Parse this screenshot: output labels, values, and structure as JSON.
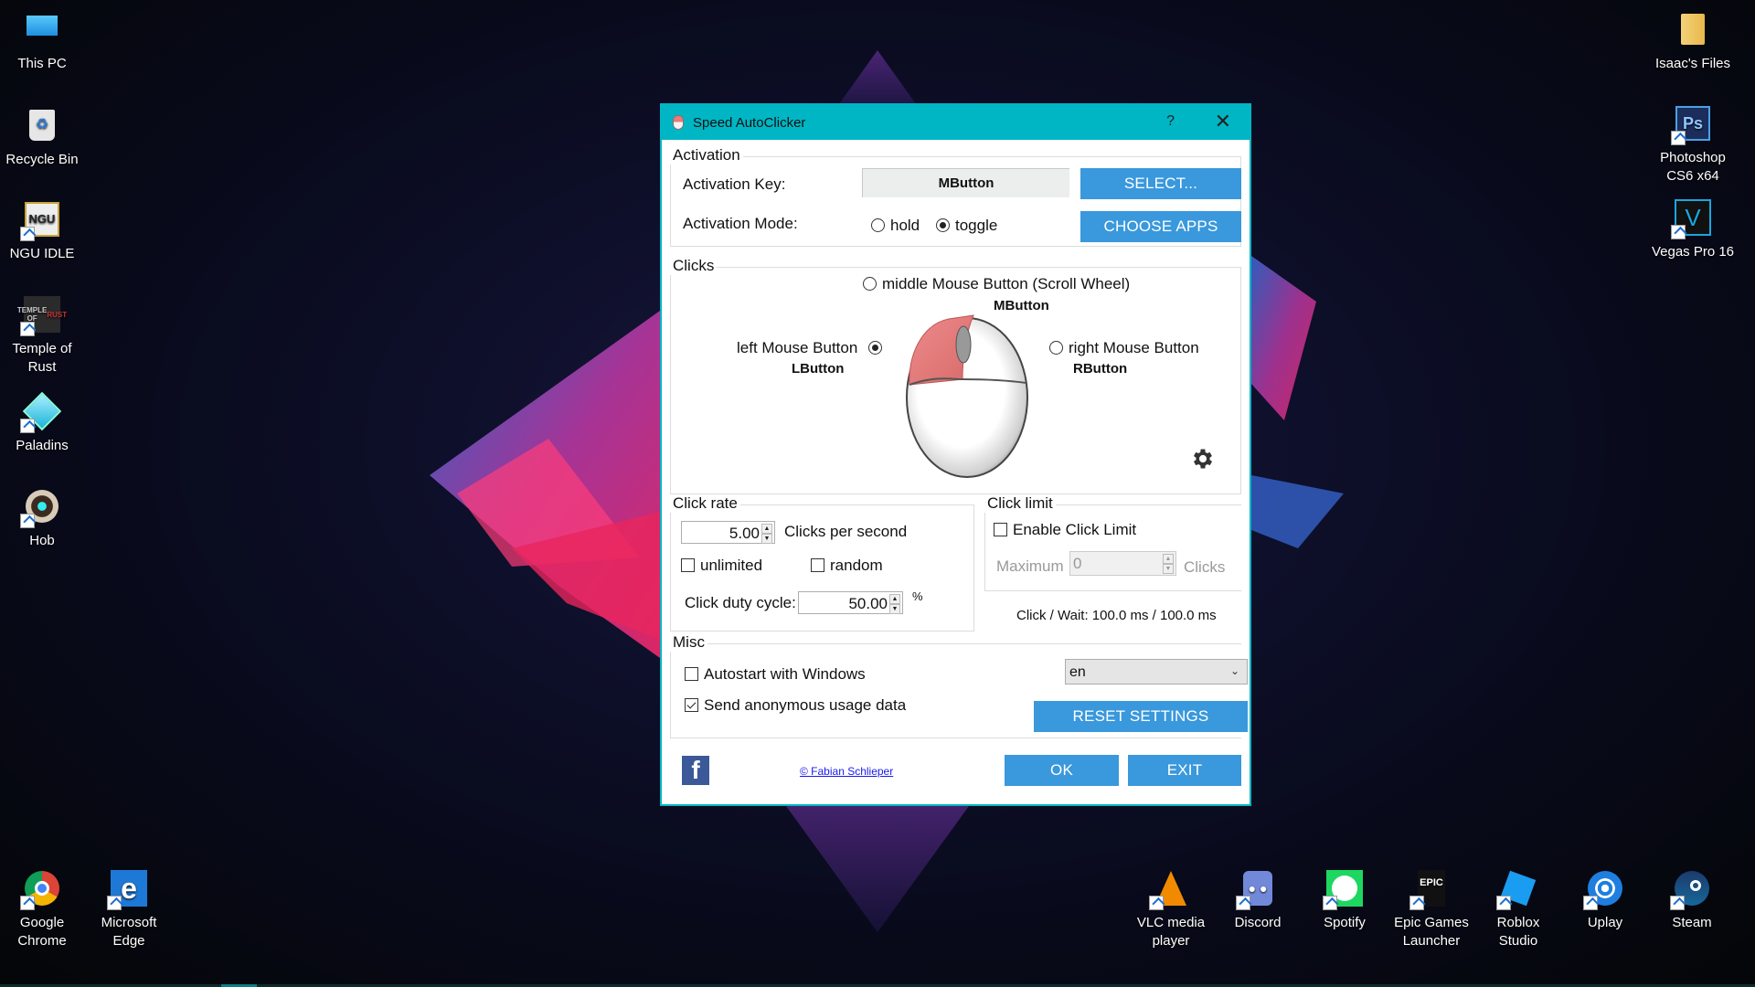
{
  "desktop": {
    "left_icons": [
      {
        "label": "This PC",
        "icon": "computer-icon"
      },
      {
        "label": "Recycle Bin",
        "icon": "recycle-bin-icon"
      },
      {
        "label": "NGU IDLE",
        "icon": "ngu-idle-icon"
      },
      {
        "label": "Temple of Rust",
        "icon": "temple-of-rust-icon"
      },
      {
        "label": "Paladins",
        "icon": "paladins-icon"
      },
      {
        "label": "Hob",
        "icon": "hob-icon"
      }
    ],
    "right_icons": [
      {
        "label": "Isaac's Files",
        "icon": "folder-icon"
      },
      {
        "label": "Photoshop CS6 x64",
        "icon": "photoshop-icon"
      },
      {
        "label": "Vegas Pro 16",
        "icon": "vegas-icon"
      }
    ],
    "bottom_left_icons": [
      {
        "label": "Google Chrome",
        "icon": "chrome-icon"
      },
      {
        "label": "Microsoft Edge",
        "icon": "edge-icon"
      }
    ],
    "bottom_right_icons": [
      {
        "label": "VLC media player",
        "icon": "vlc-icon"
      },
      {
        "label": "Discord",
        "icon": "discord-icon"
      },
      {
        "label": "Spotify",
        "icon": "spotify-icon"
      },
      {
        "label": "Epic Games Launcher",
        "icon": "epic-games-icon"
      },
      {
        "label": "Roblox Studio",
        "icon": "roblox-studio-icon"
      },
      {
        "label": "Uplay",
        "icon": "uplay-icon"
      },
      {
        "label": "Steam",
        "icon": "steam-icon"
      }
    ]
  },
  "dialog": {
    "title": "Speed AutoClicker",
    "help_label": "?",
    "close_label": "✕",
    "activation": {
      "group_title": "Activation",
      "key_label": "Activation Key:",
      "key_value": "MButton",
      "select_button": "SELECT...",
      "mode_label": "Activation Mode:",
      "mode_options": [
        "hold",
        "toggle"
      ],
      "mode_selected": "toggle",
      "choose_apps_button": "CHOOSE APPS"
    },
    "clicks": {
      "group_title": "Clicks",
      "middle_label": "middle Mouse Button (Scroll Wheel)",
      "middle_key": "MButton",
      "left_label": "left Mouse Button",
      "left_key": "LButton",
      "right_label": "right Mouse Button",
      "right_key": "RButton",
      "selected": "left"
    },
    "click_rate": {
      "group_title": "Click rate",
      "rate_value": "5.00",
      "rate_unit": "Clicks per second",
      "unlimited_label": "unlimited",
      "unlimited_checked": false,
      "random_label": "random",
      "random_checked": false,
      "duty_label": "Click duty cycle:",
      "duty_value": "50.00",
      "duty_unit": "%"
    },
    "click_limit": {
      "group_title": "Click limit",
      "enable_label": "Enable Click Limit",
      "enable_checked": false,
      "maximum_label": "Maximum",
      "maximum_value": "0",
      "maximum_unit": "Clicks"
    },
    "timing_text": "Click / Wait: 100.0 ms / 100.0 ms",
    "misc": {
      "group_title": "Misc",
      "autostart_label": "Autostart with Windows",
      "autostart_checked": false,
      "usage_label": "Send anonymous usage data",
      "usage_checked": true,
      "language_value": "en",
      "reset_button": "RESET SETTINGS"
    },
    "footer": {
      "facebook_glyph": "f",
      "copyright_link": "© Fabian Schlieper",
      "ok_button": "OK",
      "exit_button": "EXIT"
    }
  },
  "colors": {
    "titlebar": "#00b6c4",
    "button": "#3a98dc"
  }
}
